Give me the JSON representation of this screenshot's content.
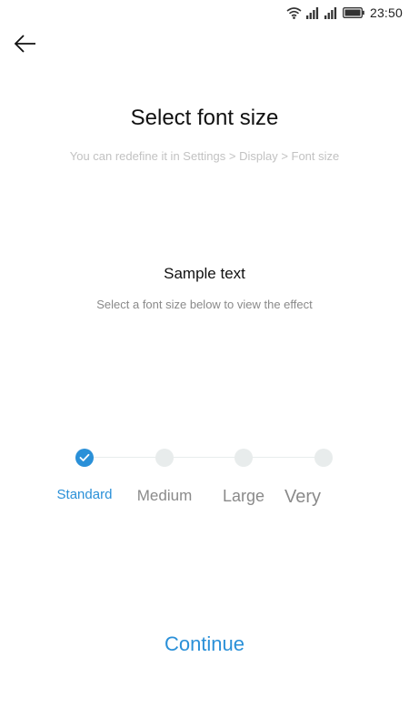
{
  "status_bar": {
    "time": "23:50",
    "icons": [
      "wifi-icon",
      "signal-icon",
      "signal-icon",
      "battery-icon"
    ]
  },
  "header": {
    "back_icon": "arrow-left-icon"
  },
  "main": {
    "title": "Select font size",
    "subtitle": "You can redefine it in Settings > Display > Font size",
    "sample_title": "Sample text",
    "sample_desc": "Select a font size below to view the effect"
  },
  "font_sizes": {
    "selected_index": 0,
    "options": [
      {
        "label": "Standard"
      },
      {
        "label": "Medium"
      },
      {
        "label": "Large"
      },
      {
        "label": "Very"
      }
    ]
  },
  "footer": {
    "continue_label": "Continue"
  },
  "colors": {
    "accent": "#2a90d8",
    "inactive_dot": "#e8ecec",
    "muted_text": "#8a8a8a"
  }
}
